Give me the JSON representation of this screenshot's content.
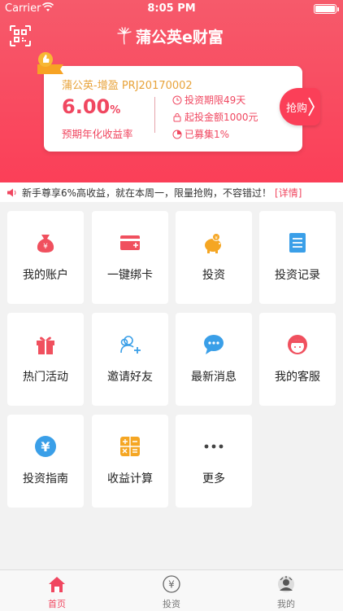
{
  "status_bar": {
    "carrier": "Carrier",
    "time": "8:05 PM"
  },
  "header": {
    "brand_name": "蒲公英e财富"
  },
  "product_card": {
    "badge": "推荐",
    "name": "蒲公英-增盈 PRJ20170002",
    "rate_value": "6.00",
    "rate_unit": "%",
    "rate_label": "预期年化收益率",
    "term": "投资期限49天",
    "min_amount": "起投金额1000元",
    "raised": "已募集1%",
    "buy_label": "抢购"
  },
  "notice": {
    "text": "新手尊享6%高收益，就在本周一，限量抢购，不容错过！",
    "detail": "[详情]"
  },
  "menu": [
    {
      "label": "我的账户",
      "icon": "money-bag-icon"
    },
    {
      "label": "一键绑卡",
      "icon": "bank-card-icon"
    },
    {
      "label": "投资",
      "icon": "piggy-bank-icon"
    },
    {
      "label": "投资记录",
      "icon": "record-list-icon"
    },
    {
      "label": "热门活动",
      "icon": "gift-icon"
    },
    {
      "label": "邀请好友",
      "icon": "invite-friend-icon"
    },
    {
      "label": "最新消息",
      "icon": "message-icon"
    },
    {
      "label": "我的客服",
      "icon": "customer-service-icon"
    },
    {
      "label": "投资指南",
      "icon": "yuan-guide-icon"
    },
    {
      "label": "收益计算",
      "icon": "calculator-icon"
    },
    {
      "label": "更多",
      "icon": "more-icon"
    }
  ],
  "tabbar": [
    {
      "label": "首页",
      "icon": "home-icon",
      "active": true
    },
    {
      "label": "投资",
      "icon": "yuan-circle-icon",
      "active": false
    },
    {
      "label": "我的",
      "icon": "avatar-icon",
      "active": false
    }
  ],
  "colors": {
    "brand_red": "#fb3f58",
    "accent_gold": "#e8a33a",
    "text_red": "#f04760"
  }
}
